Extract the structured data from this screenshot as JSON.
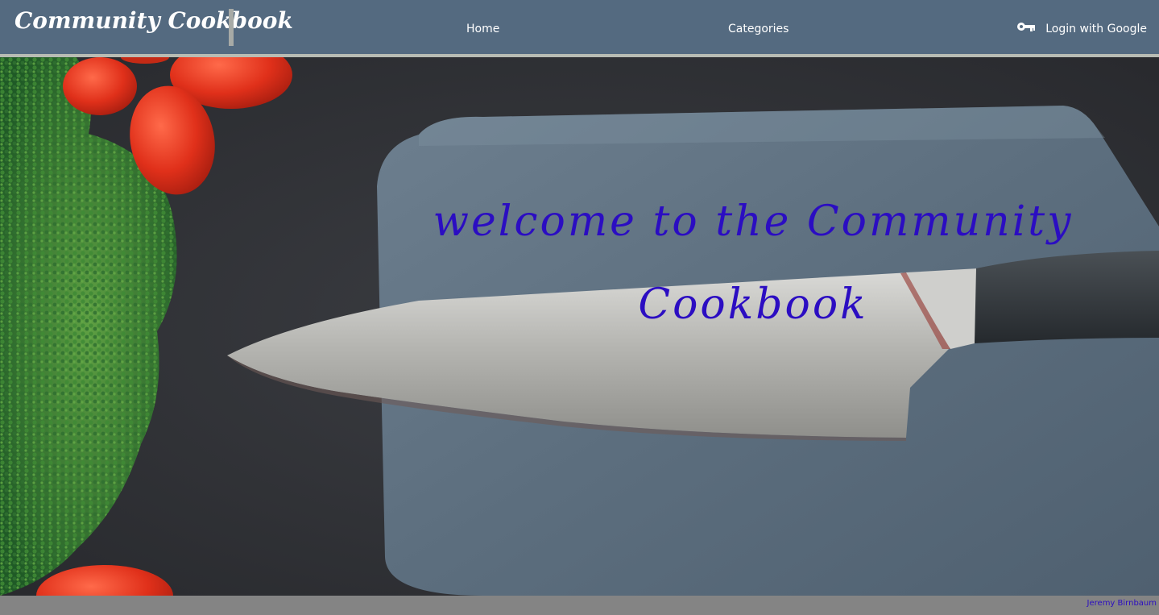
{
  "header": {
    "brand": "Community Cookbook",
    "nav": {
      "home": "Home",
      "categories": "Categories",
      "login": "Login with Google"
    },
    "login_icon": "key-icon"
  },
  "hero": {
    "welcome": "welcome to the Community Cookbook",
    "background_image": "knife on slate board with broccoli and cherry tomatoes"
  },
  "footer": {
    "author": "Jeremy Birnbaum"
  },
  "colors": {
    "navbar": "#546a80",
    "accent_text": "#2b0dc2",
    "footer": "#848484"
  }
}
